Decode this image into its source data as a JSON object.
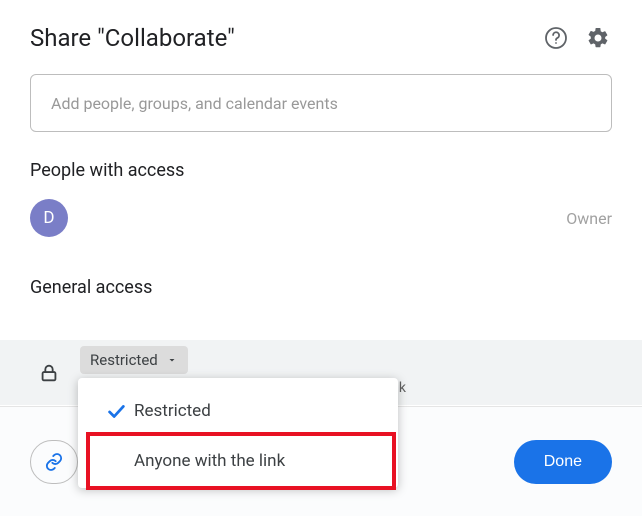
{
  "header": {
    "title": "Share \"Collaborate\""
  },
  "input": {
    "placeholder": "Add people, groups, and calendar events"
  },
  "people": {
    "section_title": "People with access",
    "avatar_initial": "D",
    "role": "Owner"
  },
  "general": {
    "section_title": "General access",
    "selected": "Restricted",
    "truncated_hint": "k"
  },
  "menu": {
    "option1": "Restricted",
    "option2": "Anyone with the link"
  },
  "footer": {
    "done": "Done"
  }
}
